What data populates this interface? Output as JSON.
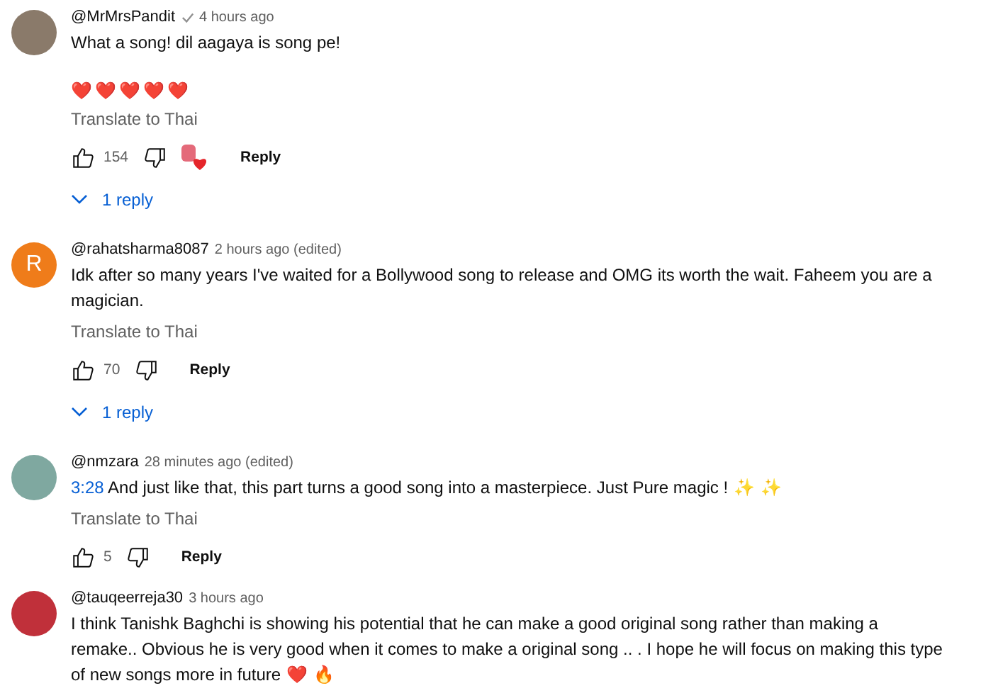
{
  "comments": [
    {
      "author": "@MrMrsPandit",
      "verified": true,
      "time": "4 hours ago",
      "avatar": {
        "kind": "photo",
        "color": "#8a7a6a"
      },
      "body": "What a song! dil aagaya is song pe!",
      "emoji_line": [
        "❤️",
        "❤️",
        "❤️",
        "❤️",
        "❤️"
      ],
      "translate": "Translate to Thai",
      "likes": "154",
      "creator_heart": true,
      "reply": "Reply",
      "replies": "1 reply"
    },
    {
      "author": "@rahatsharma8087",
      "verified": false,
      "time": "2 hours ago (edited)",
      "avatar": {
        "kind": "letter",
        "letter": "R",
        "color": "#ef7c1a"
      },
      "body": "Idk after so many years I've waited for a Bollywood song to release and OMG its worth the wait. Faheem you are a magician.",
      "translate": "Translate to Thai",
      "likes": "70",
      "creator_heart": false,
      "reply": "Reply",
      "replies": "1 reply"
    },
    {
      "author": "@nmzara",
      "verified": false,
      "time": "28 minutes ago (edited)",
      "avatar": {
        "kind": "photo",
        "color": "#7fa8a0"
      },
      "timestamp": "3:28",
      "body": "And just like that, this part turns a good song into a masterpiece. Just Pure magic !",
      "emojis": [
        "✨",
        "✨"
      ],
      "translate": "Translate to Thai",
      "likes": "5",
      "creator_heart": false,
      "reply": "Reply"
    },
    {
      "author": "@tauqeerreja30",
      "verified": false,
      "time": "3 hours ago",
      "avatar": {
        "kind": "photo",
        "color": "#c0303a"
      },
      "body": "I think Tanishk Baghchi is showing his potential that he can make a good original song rather than making a remake.. Obvious he is very good when it comes to make a original song .. . I hope he will focus on making this type of new songs more in future",
      "emojis": [
        "❤️",
        "🔥"
      ]
    }
  ]
}
